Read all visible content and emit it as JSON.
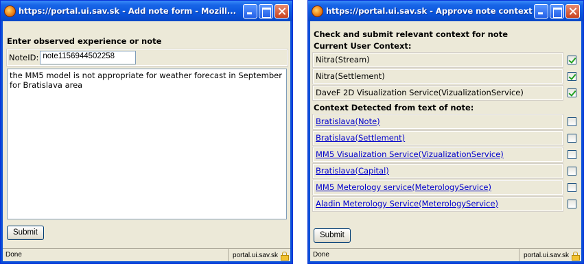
{
  "window1": {
    "title": "https://portal.ui.sav.sk - Add note form - Mozill...",
    "heading": "Enter observed experience or note",
    "note_id_label": "NoteID:",
    "note_id_value": "note1156944502258",
    "note_text": "the MM5 model is not appropriate for weather forecast in September for Bratislava area",
    "submit_label": "Submit",
    "status_text": "Done",
    "status_domain": "portal.ui.sav.sk"
  },
  "window2": {
    "title": "https://portal.ui.sav.sk - Approve note context -...",
    "heading": "Check and submit relevant context for note",
    "user_context_heading": "Current User Context:",
    "user_context": [
      {
        "label": "Nitra(Stream)",
        "checked": true
      },
      {
        "label": "Nitra(Settlement)",
        "checked": true
      },
      {
        "label": "DaveF 2D Visualization Service(VizualizationService)",
        "checked": true
      }
    ],
    "detected_heading": "Context Detected from text of note:",
    "detected_context": [
      {
        "label": "Bratislava(Note)",
        "checked": false
      },
      {
        "label": "Bratislava(Settlement)",
        "checked": false
      },
      {
        "label": "MM5 Visualization Service(VizualizationService)",
        "checked": false
      },
      {
        "label": "Bratislava(Capital)",
        "checked": false
      },
      {
        "label": "MM5 Meterology service(MeterologyService)",
        "checked": false
      },
      {
        "label": "Aladin Meterology Service(MeterologyService)",
        "checked": false
      }
    ],
    "submit_label": "Submit",
    "status_text": "Done",
    "status_domain": "portal.ui.sav.sk"
  },
  "icons": {
    "app_icon": "firefox-icon",
    "minimize": "minimize-icon",
    "maximize": "maximize-icon",
    "close": "close-icon",
    "secure": "lock-icon"
  },
  "colors": {
    "titlebar": "#0a55dc",
    "client_bg": "#ece9d8",
    "link": "#0000cc",
    "checkmark": "#21a121"
  }
}
